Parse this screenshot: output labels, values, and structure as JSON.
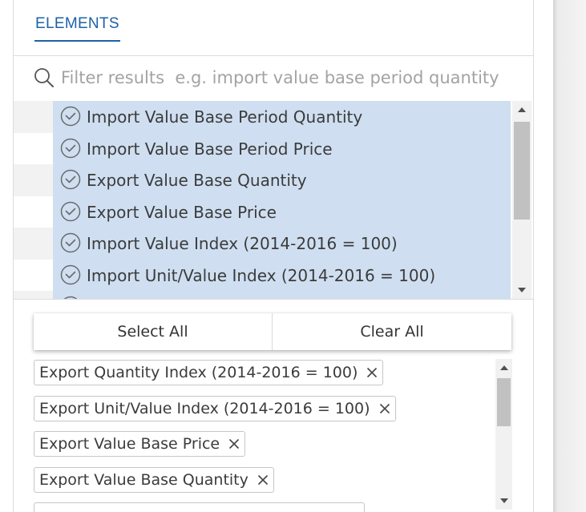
{
  "tabs": {
    "elements": "ELEMENTS"
  },
  "search": {
    "placeholder": "Filter results  e.g. import value base period quantity",
    "value": ""
  },
  "list": {
    "items": [
      {
        "label": "Import Value Base Period Quantity",
        "selected": true
      },
      {
        "label": "Import Value Base Period Price",
        "selected": true
      },
      {
        "label": "Export Value Base Quantity",
        "selected": true
      },
      {
        "label": "Export Value Base Price",
        "selected": true
      },
      {
        "label": "Import Value Index (2014-2016 = 100)",
        "selected": true
      },
      {
        "label": "Import Unit/Value Index (2014-2016 = 100)",
        "selected": true
      },
      {
        "label": "",
        "selected": true
      }
    ]
  },
  "buttons": {
    "select_all": "Select All",
    "clear_all": "Clear All"
  },
  "selected_chips": [
    {
      "label": "Export Quantity Index (2014-2016 = 100)"
    },
    {
      "label": "Export Unit/Value Index (2014-2016 = 100)"
    },
    {
      "label": "Export Value Base Price"
    },
    {
      "label": "Export Value Base Quantity"
    },
    {
      "label": ""
    }
  ],
  "colors": {
    "accent": "#1e62a6",
    "selected_row_bg": "#cfdff1",
    "stripe_alt": "#f2f2f2",
    "text": "#3b3b3b",
    "placeholder": "#a3a3a3"
  },
  "icons": {
    "search": "search-icon",
    "check": "check-circle-icon",
    "remove": "close-icon",
    "scroll_up": "triangle-up-icon",
    "scroll_down": "triangle-down-icon"
  }
}
